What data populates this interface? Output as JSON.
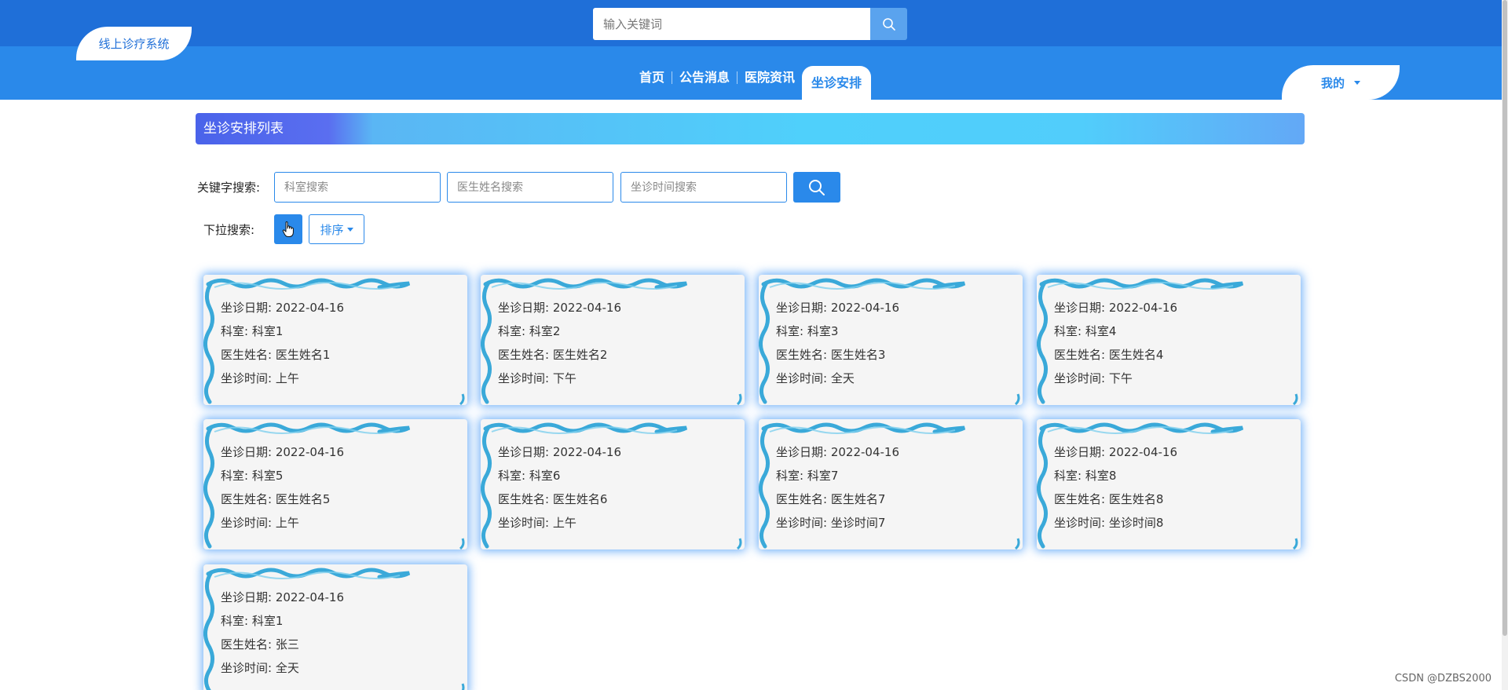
{
  "header": {
    "logo_text": "线上诊疗系统",
    "search_placeholder": "输入关键词",
    "nav": [
      "首页",
      "公告消息",
      "医院资讯",
      "坐诊安排"
    ],
    "active_nav": "坐诊安排",
    "my_menu": "我的"
  },
  "page": {
    "title": "坐诊安排列表",
    "keyword_label": "关键字搜索:",
    "keyword_placeholders": [
      "科室搜索",
      "医生姓名搜索",
      "坐诊时间搜索"
    ],
    "dropdown_label": "下拉搜索:",
    "sort_label": "排序"
  },
  "field_labels": {
    "date": "坐诊日期:",
    "dept": "科室:",
    "doctor": "医生姓名:",
    "time": "坐诊时间:"
  },
  "cards": [
    {
      "date": "2022-04-16",
      "dept": "科室1",
      "doctor": "医生姓名1",
      "time": "上午"
    },
    {
      "date": "2022-04-16",
      "dept": "科室2",
      "doctor": "医生姓名2",
      "time": "下午"
    },
    {
      "date": "2022-04-16",
      "dept": "科室3",
      "doctor": "医生姓名3",
      "time": "全天"
    },
    {
      "date": "2022-04-16",
      "dept": "科室4",
      "doctor": "医生姓名4",
      "time": "下午"
    },
    {
      "date": "2022-04-16",
      "dept": "科室5",
      "doctor": "医生姓名5",
      "time": "上午"
    },
    {
      "date": "2022-04-16",
      "dept": "科室6",
      "doctor": "医生姓名6",
      "time": "上午"
    },
    {
      "date": "2022-04-16",
      "dept": "科室7",
      "doctor": "医生姓名7",
      "time": "坐诊时间7"
    },
    {
      "date": "2022-04-16",
      "dept": "科室8",
      "doctor": "医生姓名8",
      "time": "坐诊时间8"
    },
    {
      "date": "2022-04-16",
      "dept": "科室1",
      "doctor": "张三",
      "time": "全天"
    }
  ],
  "watermark": "CSDN @DZBS2000",
  "colors": {
    "header_dark": "#1f6fd8",
    "header_light": "#2a89ea",
    "accent": "#2a89ea",
    "card_glow": "#3e94f5",
    "card_bg": "#f5f5f5",
    "ribbon": "#3aa9d9"
  },
  "icons": {
    "search": "search-icon",
    "cursor": "hand-cursor-icon",
    "caret": "caret-down-icon",
    "card_border": "wavy-ribbon-border"
  }
}
